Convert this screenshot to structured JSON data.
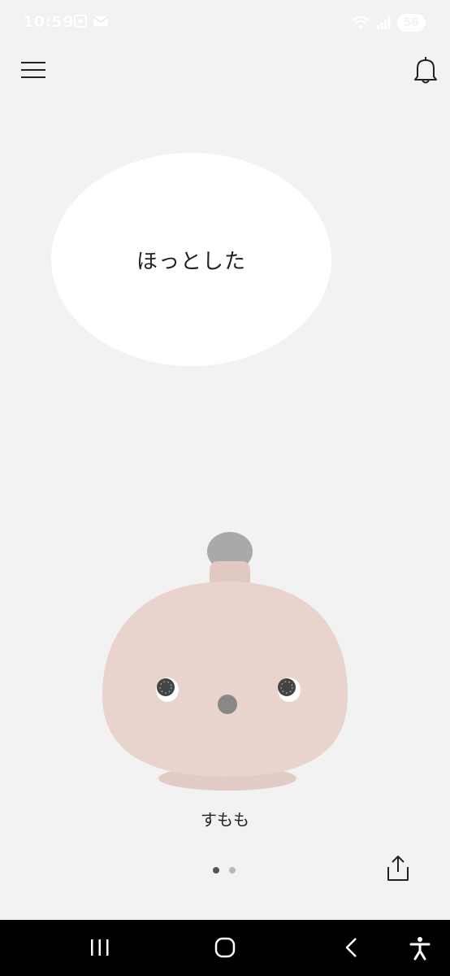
{
  "status_bar": {
    "time": "10:59",
    "battery": "56",
    "left_icons": [
      "screenshot-icon",
      "mail-icon"
    ],
    "right_icons": [
      "wifi-icon",
      "signal-icon"
    ]
  },
  "header": {
    "menu_icon": "hamburger-menu-icon",
    "notification_icon": "bell-icon"
  },
  "speech_bubble": {
    "text": "ほっとした"
  },
  "character": {
    "name": "すもも",
    "body_color": "#e8d3cd",
    "cap_color": "#a9a9a9"
  },
  "pager": {
    "page_count": 2,
    "current_page": 1
  },
  "share_icon": "share-icon",
  "nav_bar": {
    "buttons": [
      "recent-apps-icon",
      "home-icon",
      "back-icon",
      "accessibility-icon"
    ]
  }
}
